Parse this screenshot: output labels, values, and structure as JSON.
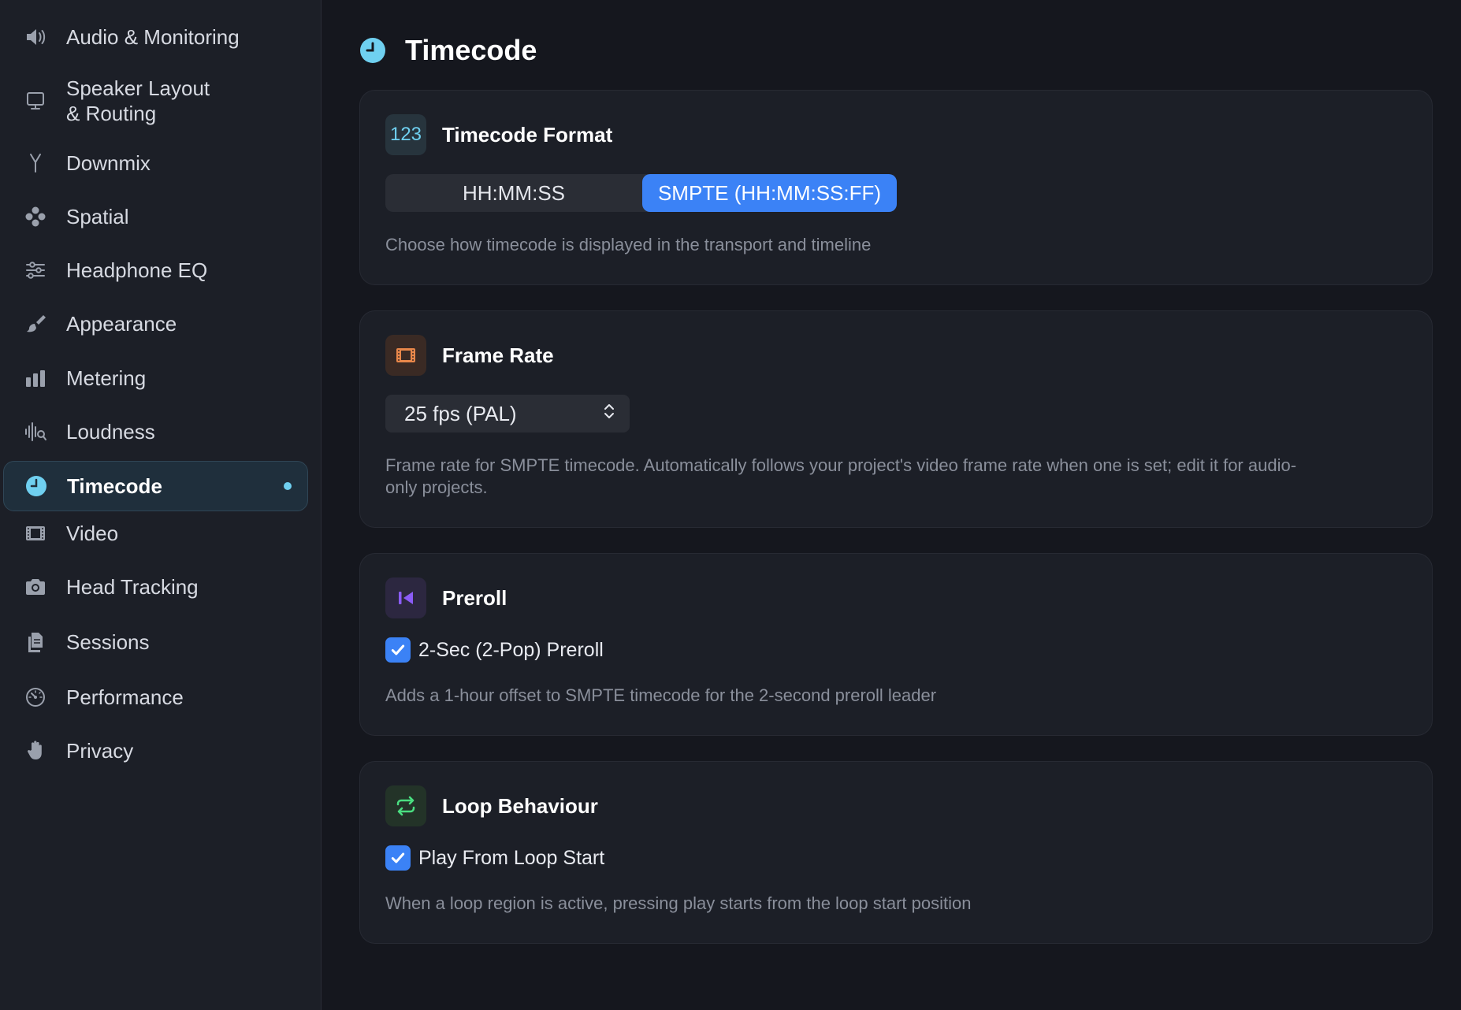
{
  "sidebar": {
    "items": [
      {
        "id": "audio",
        "label": "Audio & Monitoring",
        "icon": "speaker-icon"
      },
      {
        "id": "speaker-layout",
        "label": "Speaker Layout",
        "label2": "& Routing",
        "icon": "display-icon"
      },
      {
        "id": "downmix",
        "label": "Downmix",
        "icon": "downmix-icon"
      },
      {
        "id": "spatial",
        "label": "Spatial",
        "icon": "spatial-icon"
      },
      {
        "id": "headphone-eq",
        "label": "Headphone EQ",
        "icon": "sliders-icon"
      },
      {
        "id": "appearance",
        "label": "Appearance",
        "icon": "paintbrush-icon"
      },
      {
        "id": "metering",
        "label": "Metering",
        "icon": "meter-bars-icon"
      },
      {
        "id": "loudness",
        "label": "Loudness",
        "icon": "waveform-magnifier-icon"
      },
      {
        "id": "timecode",
        "label": "Timecode",
        "icon": "clock-icon",
        "active": true
      },
      {
        "id": "video",
        "label": "Video",
        "icon": "film-icon"
      },
      {
        "id": "head-tracking",
        "label": "Head Tracking",
        "icon": "camera-icon"
      },
      {
        "id": "sessions",
        "label": "Sessions",
        "icon": "documents-icon"
      },
      {
        "id": "performance",
        "label": "Performance",
        "icon": "gauge-icon"
      },
      {
        "id": "privacy",
        "label": "Privacy",
        "icon": "hand-icon"
      }
    ]
  },
  "page": {
    "title": "Timecode",
    "icon": "clock-icon"
  },
  "cards": {
    "format": {
      "title": "Timecode Format",
      "icon_text": "123",
      "options": [
        "HH:MM:SS",
        "SMPTE (HH:MM:SS:FF)"
      ],
      "selected": "SMPTE (HH:MM:SS:FF)",
      "description": "Choose how timecode is displayed in the transport and timeline"
    },
    "frame_rate": {
      "title": "Frame Rate",
      "icon": "film-icon",
      "value": "25 fps (PAL)",
      "description_line1": "Frame rate for SMPTE timecode. Automatically follows your project's video frame rate when one is set; edit it for audio-",
      "description_line2": "only projects."
    },
    "preroll": {
      "title": "Preroll",
      "icon": "skip-back-icon",
      "checkbox_label": "2-Sec (2-Pop) Preroll",
      "checked": true,
      "description": "Adds a 1-hour offset to SMPTE timecode for the 2-second preroll leader"
    },
    "loop": {
      "title": "Loop Behaviour",
      "icon": "repeat-icon",
      "checkbox_label": "Play From Loop Start",
      "checked": true,
      "description": "When a loop region is active, pressing play starts from the loop start position"
    }
  },
  "colors": {
    "accent_blue": "#3b82f6",
    "active_cyan": "#6fd0f0",
    "orange": "#e8874a",
    "purple": "#8b5cf6",
    "green": "#4ade80"
  }
}
